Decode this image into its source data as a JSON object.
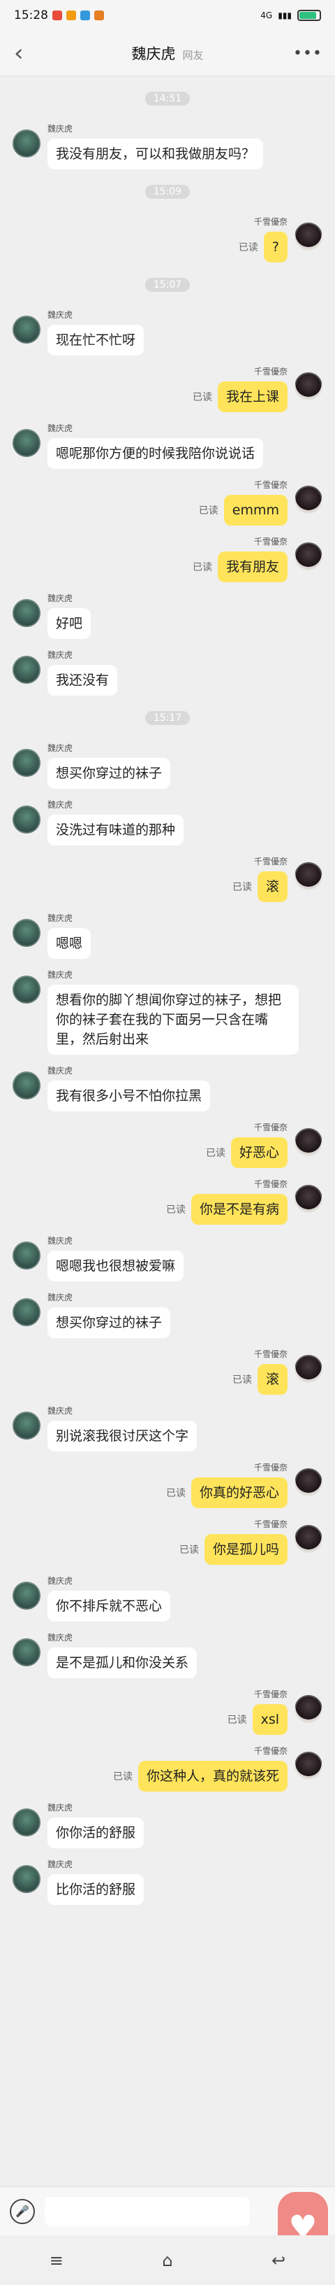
{
  "status_bar": {
    "time": "15:28",
    "network": "4G"
  },
  "header": {
    "back": "‹",
    "name": "魏庆虎",
    "tag": "网友",
    "more": "•••"
  },
  "read_label": "已读",
  "contacts": {
    "other": "魏庆虎",
    "me": "千雪優奈"
  },
  "messages": [
    {
      "type": "time",
      "text": "14:51"
    },
    {
      "type": "msg",
      "from": "other",
      "text": "我没有朋友，可以和我做朋友吗？"
    },
    {
      "type": "time",
      "text": "15:09"
    },
    {
      "type": "msg",
      "from": "me",
      "text": "?"
    },
    {
      "type": "time",
      "text": "15:07"
    },
    {
      "type": "msg",
      "from": "other",
      "text": "现在忙不忙呀"
    },
    {
      "type": "msg",
      "from": "me",
      "text": "我在上课"
    },
    {
      "type": "msg",
      "from": "other",
      "text": "嗯呢那你方便的时候我陪你说说话"
    },
    {
      "type": "msg",
      "from": "me",
      "text": "emmm"
    },
    {
      "type": "msg",
      "from": "me",
      "text": "我有朋友"
    },
    {
      "type": "msg",
      "from": "other",
      "text": "好吧"
    },
    {
      "type": "msg",
      "from": "other",
      "text": "我还没有"
    },
    {
      "type": "time",
      "text": "15:17"
    },
    {
      "type": "msg",
      "from": "other",
      "text": "想买你穿过的袜子"
    },
    {
      "type": "msg",
      "from": "other",
      "text": "没洗过有味道的那种"
    },
    {
      "type": "msg",
      "from": "me",
      "text": "滚"
    },
    {
      "type": "msg",
      "from": "other",
      "text": "嗯嗯"
    },
    {
      "type": "msg",
      "from": "other",
      "text": "想看你的脚丫想闻你穿过的袜子，想把你的袜子套在我的下面另一只含在嘴里，然后射出来"
    },
    {
      "type": "msg",
      "from": "other",
      "text": "我有很多小号不怕你拉黑"
    },
    {
      "type": "msg",
      "from": "me",
      "text": "好恶心"
    },
    {
      "type": "msg",
      "from": "me",
      "text": "你是不是有病"
    },
    {
      "type": "msg",
      "from": "other",
      "text": "嗯嗯我也很想被爱嘛"
    },
    {
      "type": "msg",
      "from": "other",
      "text": "想买你穿过的袜子"
    },
    {
      "type": "msg",
      "from": "me",
      "text": "滚"
    },
    {
      "type": "msg",
      "from": "other",
      "text": "别说滚我很讨厌这个字"
    },
    {
      "type": "msg",
      "from": "me",
      "text": "你真的好恶心"
    },
    {
      "type": "msg",
      "from": "me",
      "text": "你是孤儿吗"
    },
    {
      "type": "msg",
      "from": "other",
      "text": "你不排斥就不恶心"
    },
    {
      "type": "msg",
      "from": "other",
      "text": "是不是孤儿和你没关系"
    },
    {
      "type": "msg",
      "from": "me",
      "text": "xsl"
    },
    {
      "type": "msg",
      "from": "me",
      "text": "你这种人，真的就该死"
    },
    {
      "type": "msg",
      "from": "other",
      "text": "你你活的舒服"
    },
    {
      "type": "msg",
      "from": "other",
      "text": "比你活的舒服"
    }
  ],
  "input": {
    "placeholder": ""
  },
  "colors": {
    "my_bubble": "#ffe45b",
    "other_bubble": "#ffffff",
    "fab": "#f08a86"
  },
  "icons": {
    "voice": "voice-icon",
    "heart": "heart-icon",
    "back": "chevron-left-icon",
    "more": "more-dots-icon"
  },
  "system_nav": {
    "menu": "≡",
    "home": "⌂",
    "back": "↩"
  }
}
